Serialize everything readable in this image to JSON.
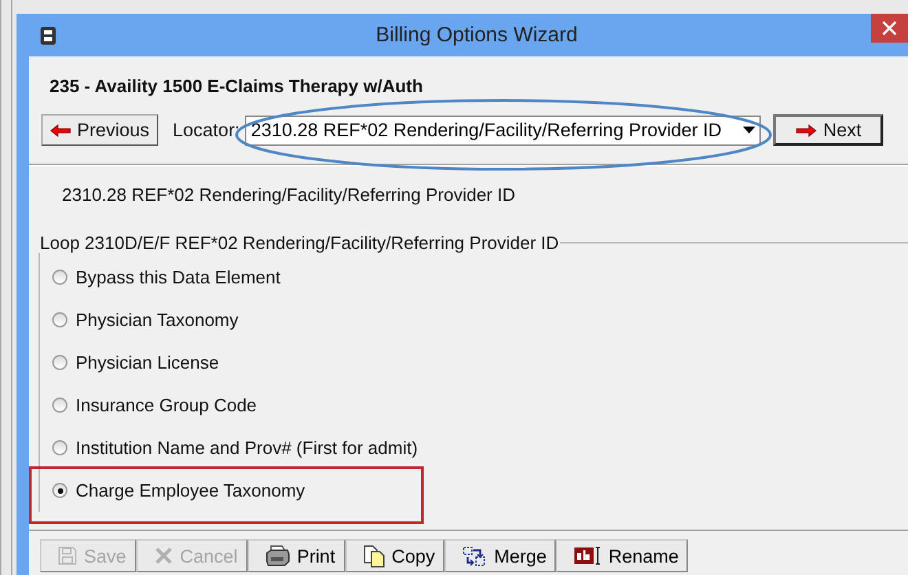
{
  "window": {
    "title": "Billing Options Wizard"
  },
  "header": "235 - Availity 1500 E-Claims Therapy w/Auth",
  "navigation": {
    "previous": "Previous",
    "locator_label": "Locator:",
    "locator_value": "2310.28 REF*02 Rendering/Facility/Referring Provider ID",
    "next": "Next"
  },
  "element_title": "2310.28 REF*02 Rendering/Facility/Referring Provider ID",
  "group": {
    "title": "Loop 2310D/E/F REF*02 Rendering/Facility/Referring Provider ID",
    "options": [
      {
        "label": "Bypass this Data Element",
        "selected": false
      },
      {
        "label": "Physician Taxonomy",
        "selected": false
      },
      {
        "label": "Physician License",
        "selected": false
      },
      {
        "label": "Insurance Group Code",
        "selected": false
      },
      {
        "label": "Institution Name and Prov# (First for admit)",
        "selected": false
      },
      {
        "label": "Charge Employee Taxonomy",
        "selected": true
      }
    ]
  },
  "toolbar": [
    {
      "kind": "save",
      "label": "Save",
      "disabled": true
    },
    {
      "kind": "cancel",
      "label": "Cancel",
      "disabled": true
    },
    {
      "kind": "print",
      "label": "Print",
      "disabled": false
    },
    {
      "kind": "copy",
      "label": "Copy",
      "disabled": false
    },
    {
      "kind": "merge",
      "label": "Merge",
      "disabled": false
    },
    {
      "kind": "rename",
      "label": "Rename",
      "disabled": false
    }
  ],
  "annotations": [
    {
      "kind": "ellipse",
      "color": "#4f86c6"
    },
    {
      "kind": "rectangle",
      "color": "#c0282d"
    }
  ]
}
